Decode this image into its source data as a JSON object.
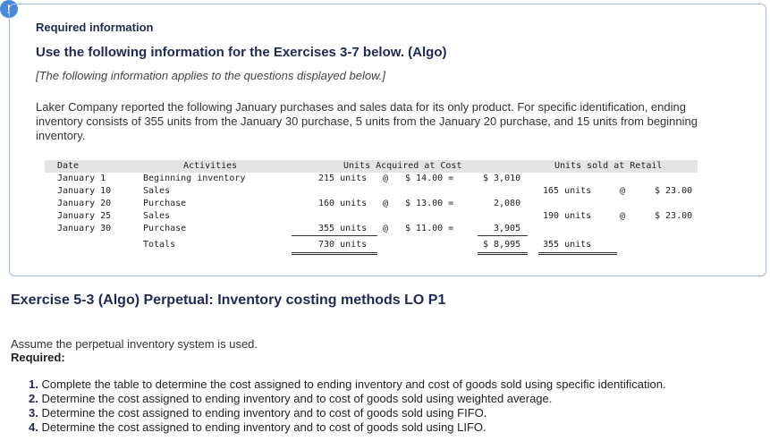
{
  "alert": {
    "icon": "exclamation-icon",
    "glyph": "!"
  },
  "header": {
    "required_info": "Required information",
    "use_following": "Use the following information for the Exercises 3-7 below. (Algo)",
    "applies_note": "[The following information applies to the questions displayed below.]",
    "intro": "Laker Company reported the following January purchases and sales data for its only product. For specific identification, ending inventory consists of 355 units from the January 30 purchase, 5 units from the January 20 purchase, and 15 units from beginning inventory."
  },
  "table": {
    "headers": {
      "date": "Date",
      "activities": "Activities",
      "acquired": "Units Acquired at Cost",
      "sold": "Units sold at Retail"
    },
    "rows": [
      {
        "date": "January 1",
        "activity": "Beginning inventory",
        "acq_units": "215 units",
        "acq_at": "@",
        "acq_cost": "$ 14.00 =",
        "acq_total": "$ 3,010",
        "sold_units": "",
        "sold_at": "",
        "sold_price": ""
      },
      {
        "date": "January 10",
        "activity": "Sales",
        "acq_units": "",
        "acq_at": "",
        "acq_cost": "",
        "acq_total": "",
        "sold_units": "165 units",
        "sold_at": "@",
        "sold_price": "$ 23.00"
      },
      {
        "date": "January 20",
        "activity": "Purchase",
        "acq_units": "160 units",
        "acq_at": "@",
        "acq_cost": "$ 13.00 =",
        "acq_total": "2,080",
        "sold_units": "",
        "sold_at": "",
        "sold_price": ""
      },
      {
        "date": "January 25",
        "activity": "Sales",
        "acq_units": "",
        "acq_at": "",
        "acq_cost": "",
        "acq_total": "",
        "sold_units": "190 units",
        "sold_at": "@",
        "sold_price": "$ 23.00"
      },
      {
        "date": "January 30",
        "activity": "Purchase",
        "acq_units": "355 units",
        "acq_at": "@",
        "acq_cost": "$ 11.00 =",
        "acq_total": "3,905",
        "sold_units": "",
        "sold_at": "",
        "sold_price": ""
      }
    ],
    "totals": {
      "label": "Totals",
      "acq_units": "730 units",
      "acq_total": "$ 8,995",
      "sold_units": "355 units"
    }
  },
  "exercise": {
    "title": "Exercise 5-3 (Algo) Perpetual: Inventory costing methods LO P1",
    "assume": "Assume the perpetual inventory system is used.",
    "required_label": "Required:",
    "requirements": [
      {
        "num": "1.",
        "text": "Complete the table to determine the cost assigned to ending inventory and cost of goods sold using specific identification."
      },
      {
        "num": "2.",
        "text": "Determine the cost assigned to ending inventory and to cost of goods sold using weighted average."
      },
      {
        "num": "3.",
        "text": "Determine the cost assigned to ending inventory and to cost of goods sold using FIFO."
      },
      {
        "num": "4.",
        "text": "Determine the cost assigned to ending inventory and to cost of goods sold using LIFO."
      }
    ]
  }
}
